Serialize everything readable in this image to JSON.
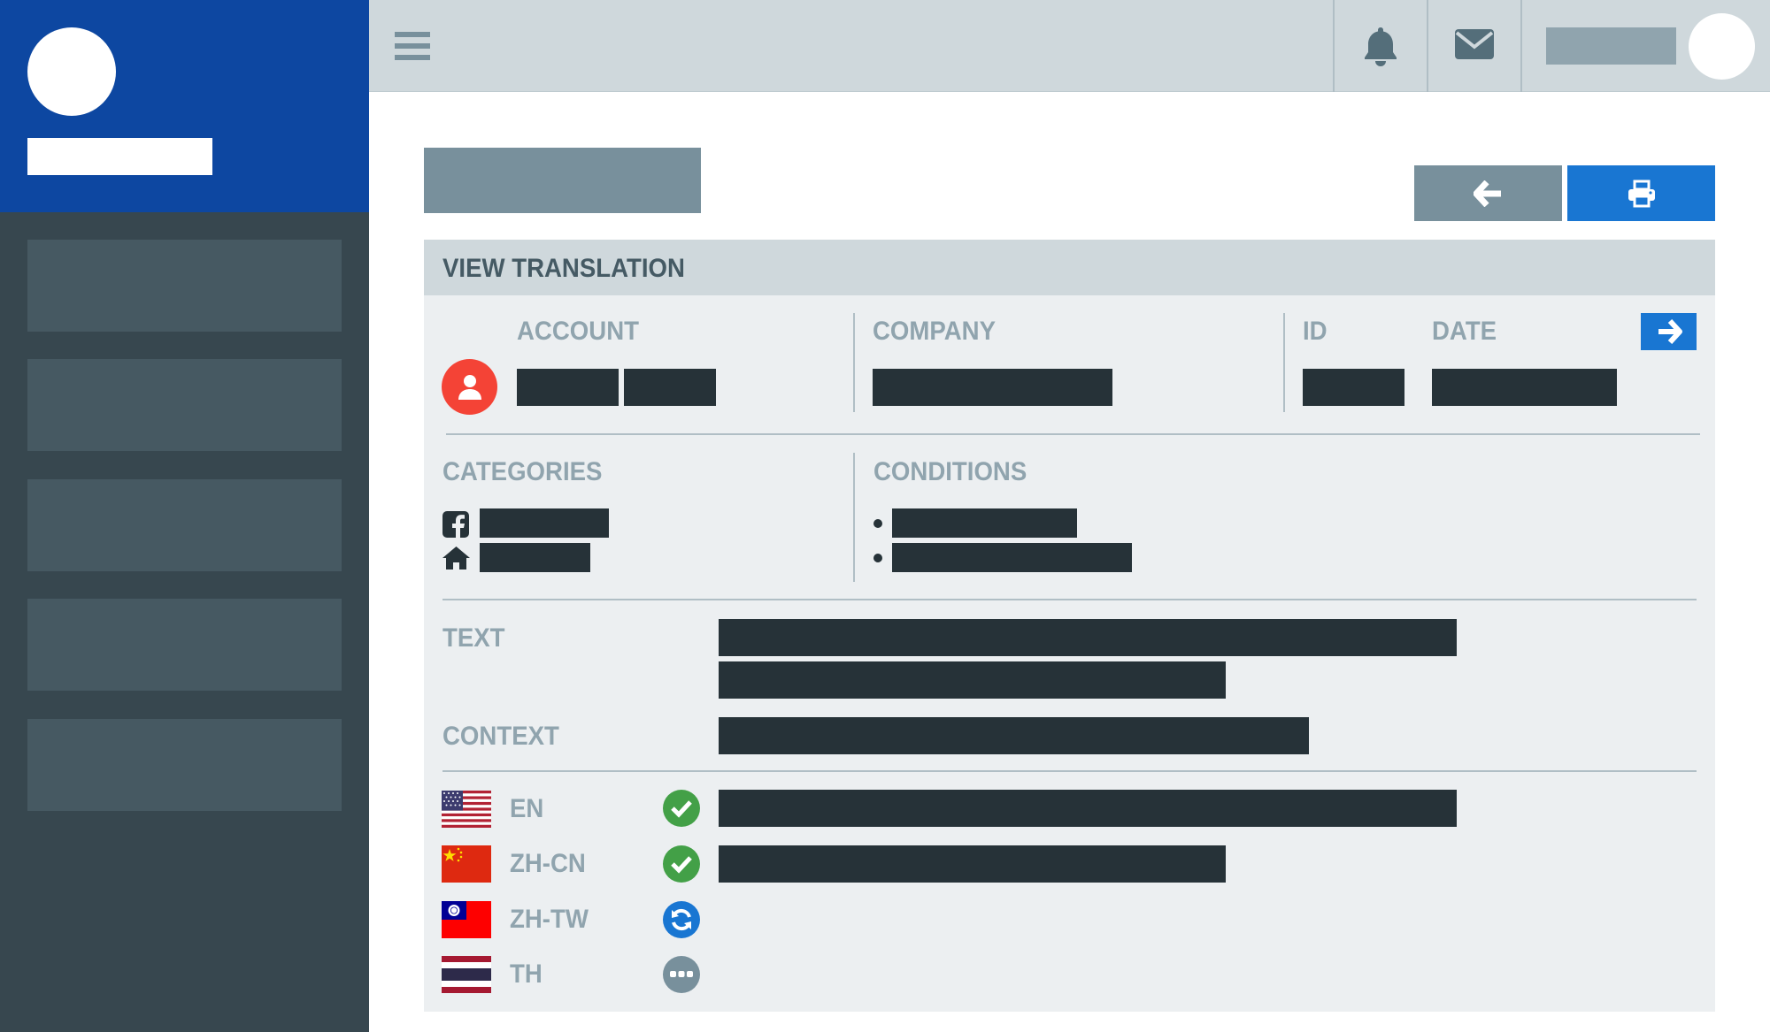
{
  "panel": {
    "title": "VIEW TRANSLATION",
    "labels": {
      "account": "ACCOUNT",
      "company": "COMPANY",
      "id": "ID",
      "date": "DATE",
      "categories": "CATEGORIES",
      "conditions": "CONDITIONS",
      "text": "TEXT",
      "context": "CONTEXT"
    }
  },
  "languages": [
    {
      "code": "EN",
      "flag": "us-flag-icon",
      "status": "done"
    },
    {
      "code": "ZH-CN",
      "flag": "cn-flag-icon",
      "status": "done"
    },
    {
      "code": "ZH-TW",
      "flag": "tw-flag-icon",
      "status": "in-progress"
    },
    {
      "code": "TH",
      "flag": "th-flag-icon",
      "status": "pending"
    }
  ],
  "colors": {
    "brand": "#0d47a1",
    "primary": "#1976d2",
    "sidebar": "#37474f",
    "account_icon": "#f44336",
    "done": "#43a047",
    "in_progress": "#1976d2",
    "pending": "#78909c"
  }
}
